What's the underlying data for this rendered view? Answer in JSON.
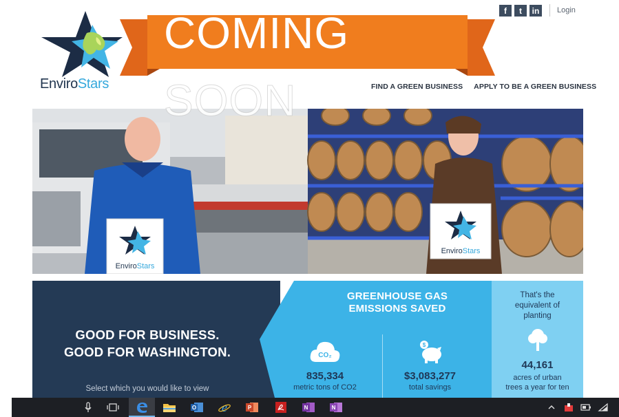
{
  "header": {
    "social": [
      "f",
      "t",
      "in"
    ],
    "social_icons": [
      "facebook-icon",
      "twitter-icon",
      "linkedin-icon"
    ],
    "login_label": "Login"
  },
  "logo": {
    "part1": "Enviro",
    "part2": "Stars"
  },
  "banner": {
    "line1": "COMING",
    "line2": "SOON",
    "color": "#f07d1e"
  },
  "nav": {
    "find": "FIND A GREEN BUSINESS",
    "apply": "APPLY TO BE A GREEN BUSINESS"
  },
  "hero": {
    "sign_left": {
      "part1": "Enviro",
      "part2": "Stars"
    },
    "sign_right": {
      "part1": "Enviro",
      "part2": "Stars"
    }
  },
  "band": {
    "tagline_line1": "GOOD FOR BUSINESS.",
    "tagline_line2": "GOOD FOR WASHINGTON.",
    "select_hint": "Select which you would like to view",
    "gh_title_line1": "GREENHOUSE GAS",
    "gh_title_line2": "EMISSIONS SAVED",
    "co2_icon_text": "CO₂",
    "co2_value": "835,334",
    "co2_label": "metric tons of CO2",
    "savings_value": "$3,083,277",
    "savings_label": "total savings",
    "equiv_line1": "That's the",
    "equiv_line2": "equivalent of",
    "equiv_line3": "planting",
    "acres_value": "44,161",
    "acres_label_line1": "acres of urban",
    "acres_label_line2": "trees a year for ten"
  },
  "colors": {
    "navy": "#243a55",
    "blue": "#3cb3e7",
    "light_blue": "#7fd0f2",
    "orange": "#f07d1e"
  },
  "taskbar": {
    "icons": [
      "microphone-icon",
      "task-view-icon",
      "edge-icon",
      "file-explorer-icon",
      "outlook-icon",
      "internet-explorer-icon",
      "powerpoint-icon",
      "acrobat-icon",
      "onenote-icon",
      "onenote-2016-icon"
    ],
    "tray_icons": [
      "chevron-up-icon",
      "notification-app-icon",
      "battery-icon",
      "wifi-icon"
    ]
  }
}
